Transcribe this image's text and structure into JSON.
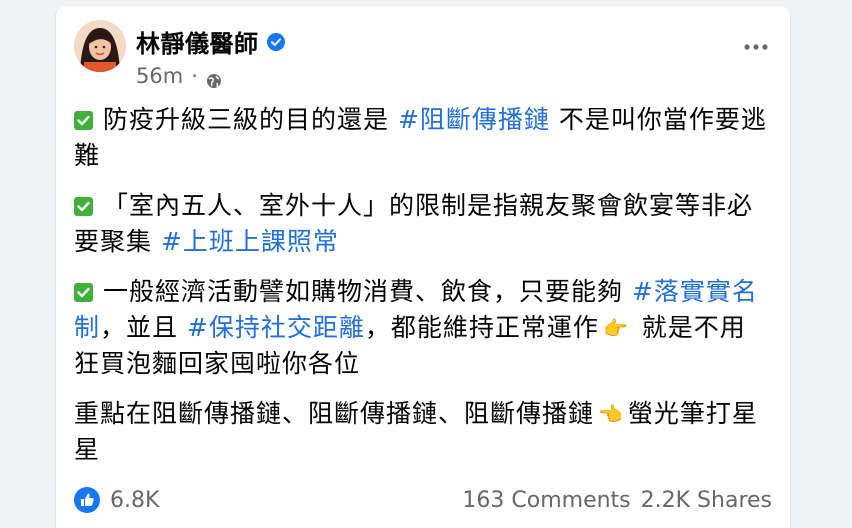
{
  "post": {
    "author": "林靜儀醫師",
    "time": "56m",
    "meta_separator": "·",
    "icons": {
      "verified": "verified-badge-icon",
      "audience": "globe-icon",
      "more": "more-options-icon",
      "check": "check-mark-button-icon",
      "like": "like-reaction-icon"
    },
    "colors": {
      "hashtag": "#216fdb",
      "verified": "#1877f2",
      "check": "#40b03a"
    },
    "paragraphs": {
      "p1": {
        "text1": "防疫升級三級的目的還是 ",
        "hashtag1": "#阻斷傳播鏈",
        "text2": " 不是叫你當作要逃難"
      },
      "p2": {
        "text1": "「室內五人、室外十人」的限制是指親友聚會飲宴等非必要聚集 ",
        "hashtag1": "#上班上課照常"
      },
      "p3": {
        "text1": "一般經濟活動譬如購物消費、飲食，只要能夠 ",
        "hashtag1": "#落實實名制",
        "text2": "，並且 ",
        "hashtag2": "#保持社交距離",
        "text3": "，都能維持正常運作",
        "emoji1": "👉",
        "text4": " 就是不用狂買泡麵回家囤啦你各位"
      },
      "p4": {
        "text1": "重點在阻斷傳播鏈、阻斷傳播鏈、阻斷傳播鏈",
        "emoji1": "👈",
        "text2": "螢光筆打星星"
      }
    },
    "footer": {
      "reactions": "6.8K",
      "comments": "163 Comments",
      "shares": "2.2K Shares"
    }
  }
}
